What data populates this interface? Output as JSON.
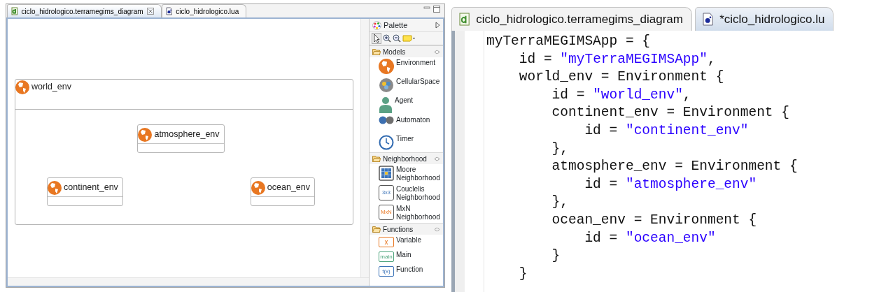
{
  "diagram_editor": {
    "tabs": [
      {
        "label": "ciclo_hidrologico.terramegims_diagram",
        "selected": true,
        "kind": "diagram"
      },
      {
        "label": "ciclo_hidrologico.lua",
        "selected": false,
        "kind": "lua"
      }
    ],
    "diagram": {
      "name": "world_env",
      "children": [
        {
          "name": "atmosphere_env"
        },
        {
          "name": "continent_env"
        },
        {
          "name": "ocean_env"
        }
      ]
    },
    "palette": {
      "title": "Palette",
      "groups": [
        {
          "label": "Models",
          "items": [
            {
              "label": "Environment",
              "kind": "environment"
            },
            {
              "label": "CellularSpace",
              "kind": "cellular-space"
            },
            {
              "label": "Agent",
              "kind": "agent"
            },
            {
              "label": "Automaton",
              "kind": "automaton"
            },
            {
              "label": "Timer",
              "kind": "timer"
            }
          ]
        },
        {
          "label": "Neighborhood",
          "items": [
            {
              "label": "Moore Neighborhood",
              "kind": "moore"
            },
            {
              "label": "Couclelis Neighborhood",
              "kind": "couclelis",
              "badge": "3x3"
            },
            {
              "label": "MxN Neighborhood",
              "kind": "mxn",
              "badge": "MxN"
            }
          ]
        },
        {
          "label": "Functions",
          "items": [
            {
              "label": "Variable",
              "kind": "variable",
              "badge": "x"
            },
            {
              "label": "Main",
              "kind": "main",
              "badge": "main"
            },
            {
              "label": "Function",
              "kind": "function",
              "badge": "f(x)"
            }
          ]
        }
      ]
    }
  },
  "code_editor": {
    "tabs": [
      {
        "label": "ciclo_hidrologico.terramegims_diagram",
        "selected": false,
        "kind": "diagram"
      },
      {
        "label": "*ciclo_hidrologico.lu",
        "selected": true,
        "kind": "lua"
      }
    ],
    "lines": [
      [
        {
          "text": "myTerraMEGIMSApp = {",
          "kind": "plain"
        }
      ],
      [
        {
          "text": "    id = ",
          "kind": "plain"
        },
        {
          "text": "\"myTerraMEGIMSApp\"",
          "kind": "string"
        },
        {
          "text": ",",
          "kind": "plain"
        }
      ],
      [
        {
          "text": "    world_env = Environment {",
          "kind": "plain"
        }
      ],
      [
        {
          "text": "        id = ",
          "kind": "plain"
        },
        {
          "text": "\"world_env\"",
          "kind": "string"
        },
        {
          "text": ",",
          "kind": "plain"
        }
      ],
      [
        {
          "text": "        continent_env = Environment {",
          "kind": "plain"
        }
      ],
      [
        {
          "text": "            id = ",
          "kind": "plain"
        },
        {
          "text": "\"continent_env\"",
          "kind": "string"
        }
      ],
      [
        {
          "text": "        },",
          "kind": "plain"
        }
      ],
      [
        {
          "text": "        atmosphere_env = Environment {",
          "kind": "plain"
        }
      ],
      [
        {
          "text": "            id = ",
          "kind": "plain"
        },
        {
          "text": "\"atmosphere_env\"",
          "kind": "string"
        }
      ],
      [
        {
          "text": "        },",
          "kind": "plain"
        }
      ],
      [
        {
          "text": "        ocean_env = Environment {",
          "kind": "plain"
        }
      ],
      [
        {
          "text": "            id = ",
          "kind": "plain"
        },
        {
          "text": "\"ocean_env\"",
          "kind": "string"
        }
      ],
      [
        {
          "text": "        }",
          "kind": "plain"
        }
      ],
      [
        {
          "text": "    }",
          "kind": "plain"
        }
      ]
    ]
  }
}
